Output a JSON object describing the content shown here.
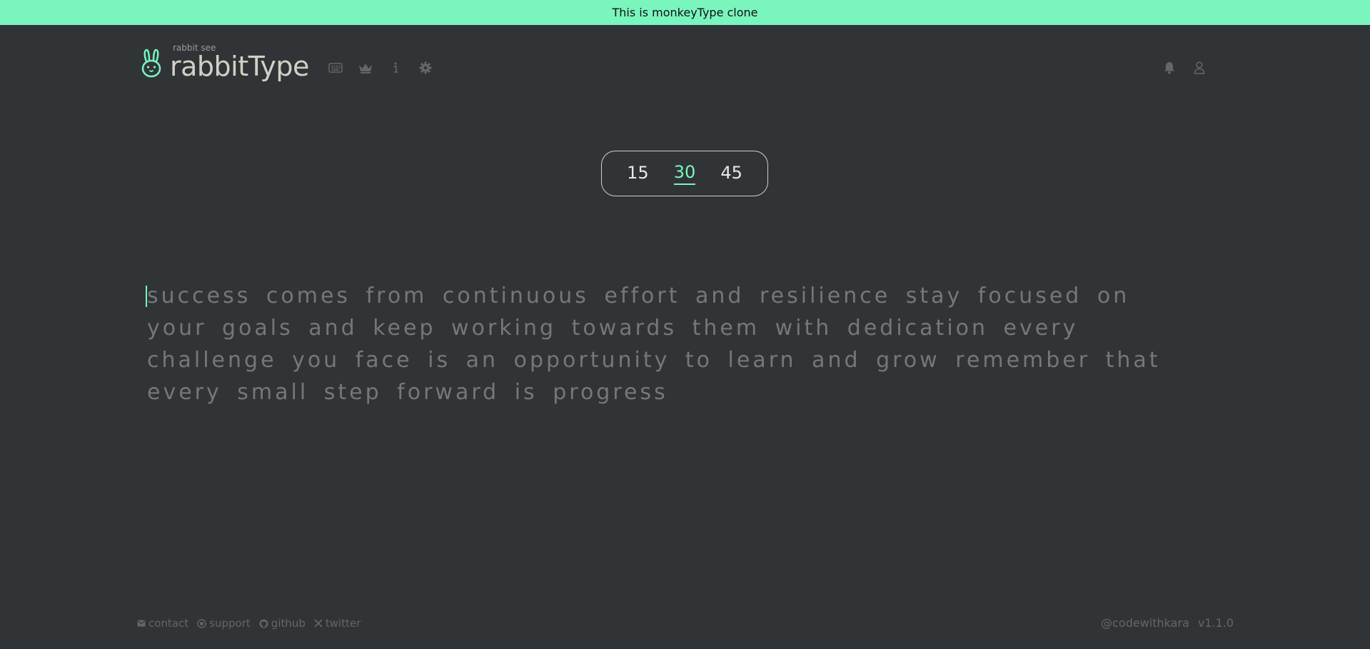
{
  "banner": {
    "text": "This is monkeyType clone"
  },
  "header": {
    "logo_sub": "rabbit see",
    "logo_title": "rabbitType",
    "nav_icons": [
      "keyboard-icon",
      "crown-icon",
      "info-icon",
      "gear-icon"
    ],
    "right_icons": [
      "bell-icon",
      "user-icon"
    ]
  },
  "time_selector": {
    "options": [
      "15",
      "30",
      "45"
    ],
    "selected": "30"
  },
  "typing": {
    "text": "success comes from continuous effort and resilience stay focused on your goals and keep working towards them with dedication every challenge you face is an opportunity to learn and grow remember that every small step forward is progress"
  },
  "footer": {
    "links": [
      {
        "label": "contact",
        "icon": "mail-icon"
      },
      {
        "label": "support",
        "icon": "donate-icon"
      },
      {
        "label": "github",
        "icon": "github-icon"
      },
      {
        "label": "twitter",
        "icon": "x-icon"
      }
    ],
    "author": "@codewithkara",
    "version": "v1.1.0"
  },
  "colors": {
    "background": "#313436",
    "accent": "#7af5be",
    "text_main": "#d1d0c5",
    "text_sub": "#75777a"
  }
}
